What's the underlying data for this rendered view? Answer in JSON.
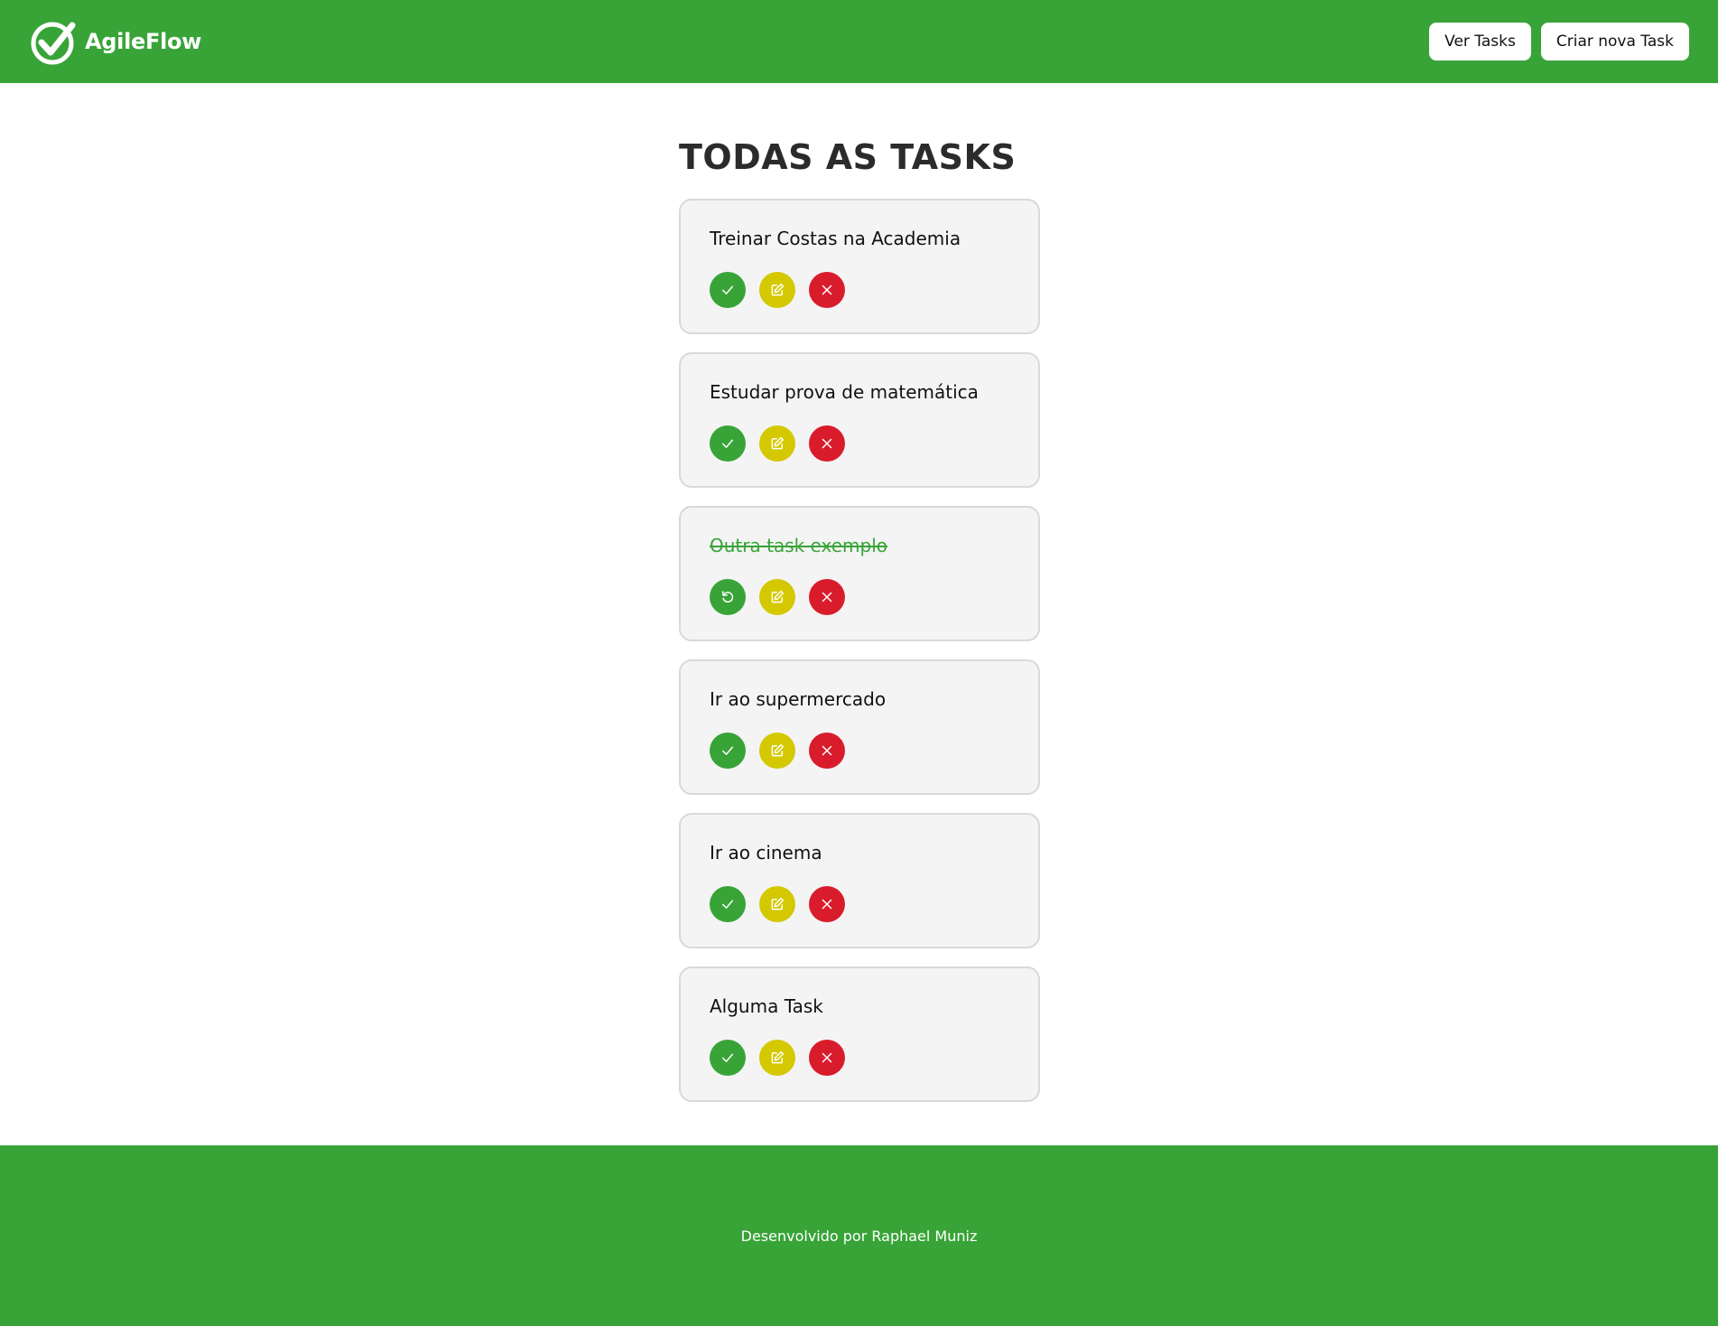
{
  "header": {
    "brand": "AgileFlow",
    "nav": [
      {
        "label": "Ver Tasks"
      },
      {
        "label": "Criar nova Task"
      }
    ]
  },
  "main": {
    "title": "TODAS AS TASKS",
    "tasks": [
      {
        "title": "Treinar Costas na Academia",
        "completed": false
      },
      {
        "title": "Estudar prova de matemática",
        "completed": false
      },
      {
        "title": "Outra task exemplo",
        "completed": true
      },
      {
        "title": "Ir ao supermercado",
        "completed": false
      },
      {
        "title": "Ir ao cinema",
        "completed": false
      },
      {
        "title": "Alguma Task",
        "completed": false
      }
    ],
    "icons": {
      "complete": "check-icon",
      "undo": "undo-icon",
      "edit": "edit-icon",
      "remove": "close-icon"
    }
  },
  "footer": {
    "text": "Desenvolvido por Raphael Muniz"
  },
  "colors": {
    "primary": "#38a438",
    "edit": "#d4c800",
    "remove": "#d91c2c",
    "card_bg": "#f4f4f4",
    "card_border": "#d9d9d9"
  }
}
